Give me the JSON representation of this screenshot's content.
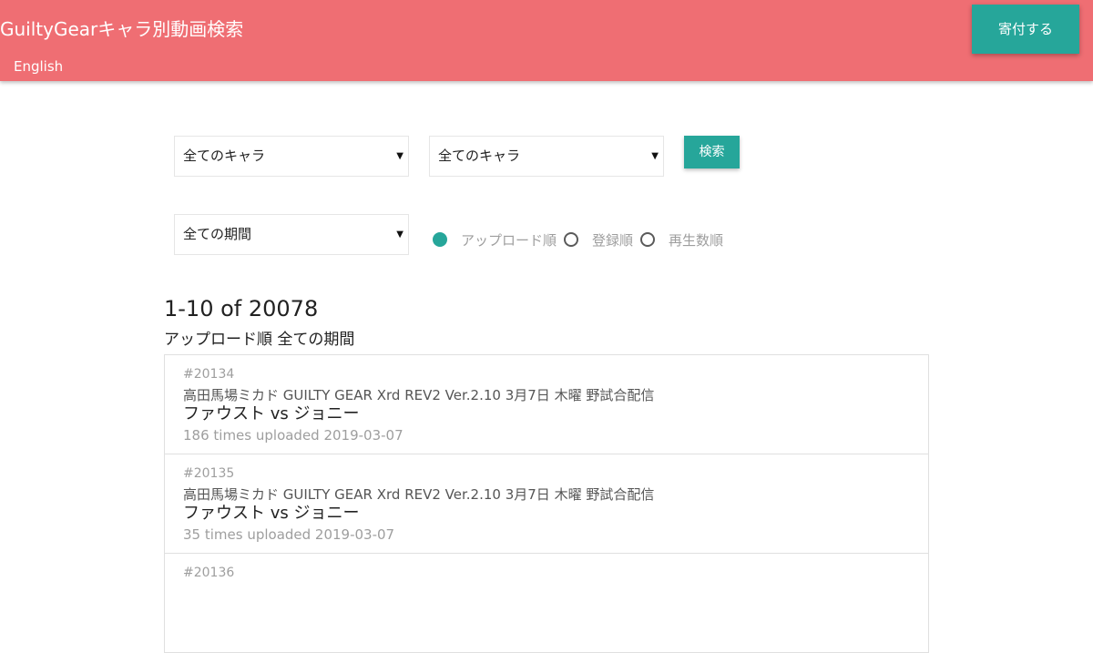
{
  "header": {
    "title": "GuiltyGearキャラ別動画検索",
    "language_link": "English",
    "donate_label": "寄付する"
  },
  "colors": {
    "header_bg": "#ef6e73",
    "accent": "#26a69a"
  },
  "filters": {
    "character1": "全てのキャラ",
    "character2": "全てのキャラ",
    "period": "全ての期間",
    "search_label": "検索",
    "sort_options": [
      {
        "label": "アップロード順",
        "checked": true
      },
      {
        "label": "登録順",
        "checked": false
      },
      {
        "label": "再生数順",
        "checked": false
      }
    ]
  },
  "results": {
    "count_text": "1-10 of 20078",
    "filter_text": "アップロード順 全ての期間",
    "items": [
      {
        "id": "#20134",
        "title": "高田馬場ミカド GUILTY GEAR Xrd REV2 Ver.2.10 3月7日 木曜 野試合配信",
        "match": "ファウスト vs ジョニー",
        "meta": "186 times uploaded 2019-03-07"
      },
      {
        "id": "#20135",
        "title": "高田馬場ミカド GUILTY GEAR Xrd REV2 Ver.2.10 3月7日 木曜 野試合配信",
        "match": "ファウスト vs ジョニー",
        "meta": "35 times uploaded 2019-03-07"
      },
      {
        "id": "#20136",
        "title": "",
        "match": "",
        "meta": ""
      }
    ]
  }
}
